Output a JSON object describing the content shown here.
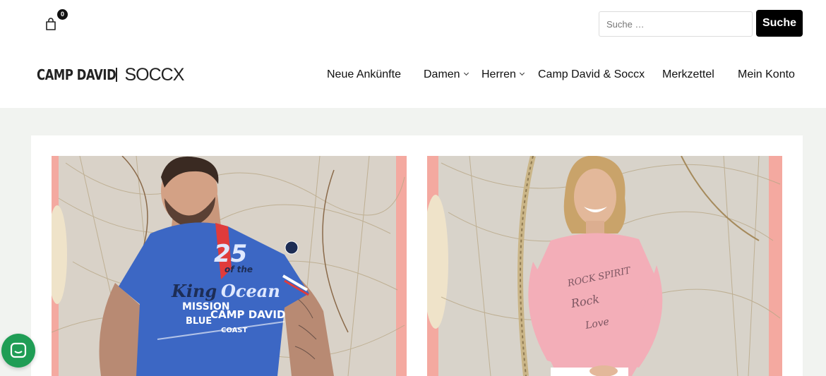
{
  "header": {
    "cart_count": "0",
    "search": {
      "placeholder": "Suche …",
      "button_label": "Suche"
    },
    "logo": {
      "left": "CAMP DAVID",
      "right": "SOCCX"
    }
  },
  "nav": {
    "items": [
      {
        "label": "Neue Ankünfte",
        "has_dropdown": false
      },
      {
        "label": "Damen",
        "has_dropdown": true
      },
      {
        "label": "Herren",
        "has_dropdown": true
      },
      {
        "label": "Camp David & Soccx",
        "has_dropdown": false
      },
      {
        "label": "Merkzettel",
        "has_dropdown": false
      },
      {
        "label": "Mein Konto",
        "has_dropdown": false
      }
    ]
  },
  "products": {
    "items": [
      {
        "image": "man-blue-polo-photo",
        "shirt_text": [
          "King",
          "of the",
          "Ocean",
          "MISSION",
          "BLUE",
          "CAMP DAVID",
          "COAST",
          "25"
        ]
      },
      {
        "image": "woman-pink-sweater-photo",
        "shirt_text": [
          "ROCK SPIRIT"
        ]
      }
    ]
  },
  "colors": {
    "accent": "#000000",
    "page_bg": "#f1f3f0",
    "chat": "#1f9d55"
  },
  "chat": {
    "icon": "chat-icon"
  }
}
